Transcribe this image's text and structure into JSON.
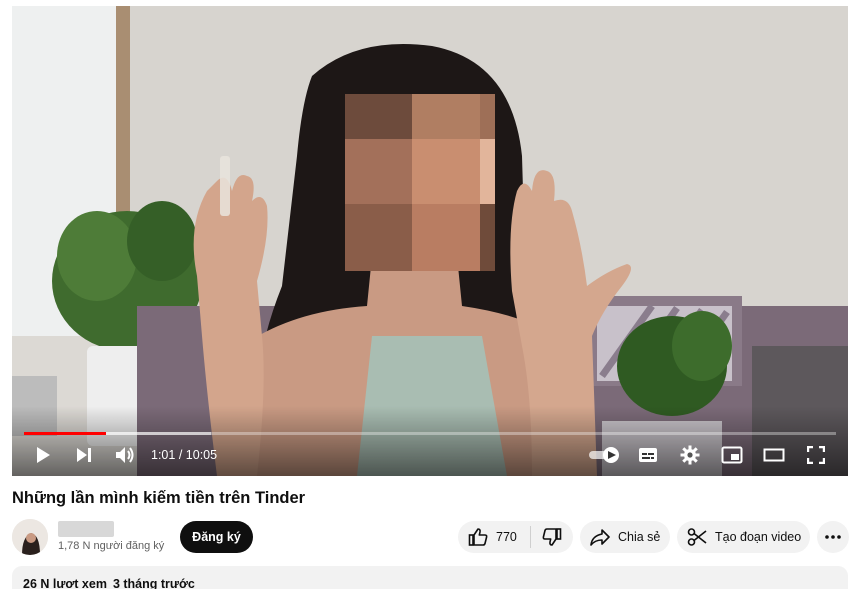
{
  "player": {
    "time_current": "1:01",
    "time_separator": "/",
    "time_total": "10:05",
    "progress_played": 0.101,
    "progress_buffered": 0.23,
    "colors": {
      "played": "#ff0000",
      "control_icons": "#ffffff"
    },
    "icons": [
      "play-icon",
      "next-icon",
      "volume-icon",
      "autoplay-toggle-icon",
      "subtitles-icon",
      "settings-icon",
      "miniplayer-icon",
      "theater-mode-icon",
      "fullscreen-icon"
    ]
  },
  "video": {
    "title": "Những lần mình kiếm tiền trên Tinder"
  },
  "channel": {
    "subscribers": "1,78 N người đăng ký",
    "subscribe_label": "Đăng ký"
  },
  "actions": {
    "like_count": "770",
    "share_label": "Chia sẻ",
    "clip_label": "Tạo đoạn video",
    "icons": [
      "like-icon",
      "dislike-icon",
      "share-icon",
      "scissors-icon",
      "more-icon"
    ]
  },
  "description": {
    "views": "26 N lượt xem",
    "age": "3 tháng trước"
  }
}
